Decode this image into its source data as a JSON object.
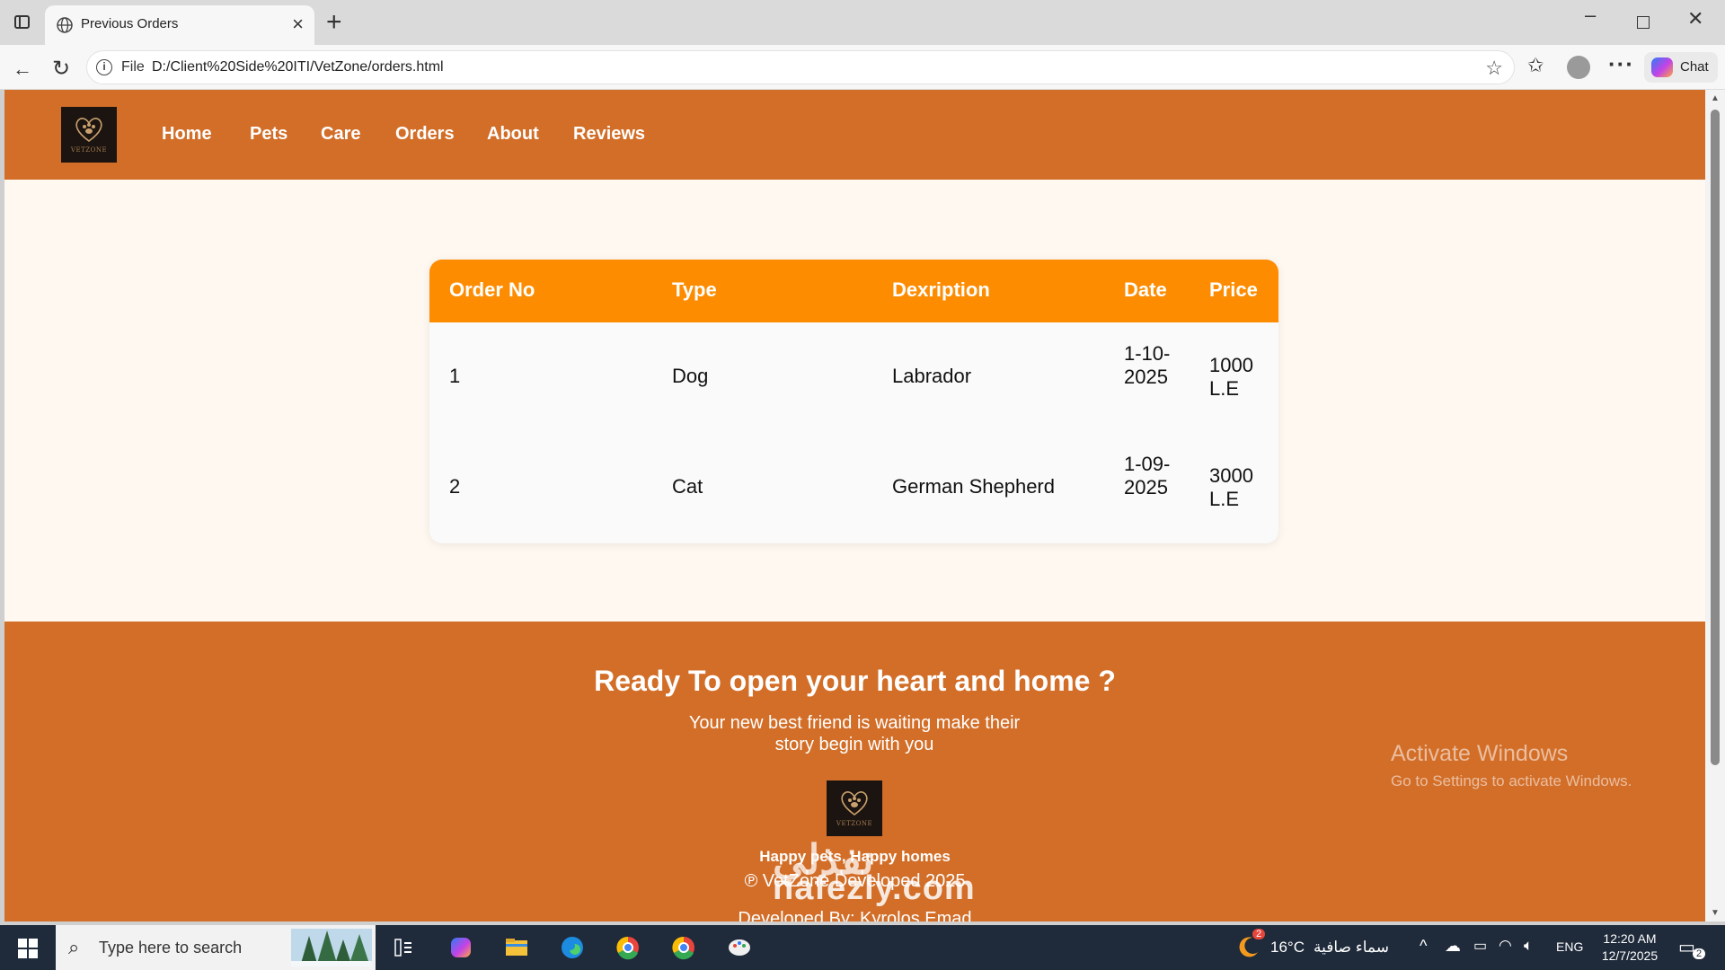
{
  "browser": {
    "tab_title": "Previous Orders",
    "url_prefix": "File",
    "url": "D:/Client%20Side%20ITI/VetZone/orders.html",
    "chat_label": "Chat"
  },
  "site": {
    "logo_text": "VETZONE",
    "nav": [
      "Home",
      "Pets",
      "Care",
      "Orders",
      "About",
      "Reviews"
    ]
  },
  "orders": {
    "headers": [
      "Order No",
      "Type",
      "Dexription",
      "Date",
      "Price"
    ],
    "rows": [
      [
        "1",
        "Dog",
        "Labrador",
        "1-10-2025",
        "1000 L.E"
      ],
      [
        "2",
        "Cat",
        "German Shepherd",
        "1-09-2025",
        "3000 L.E"
      ]
    ]
  },
  "footer": {
    "cta_title": "Ready To open your heart and home ?",
    "cta_text": "Your new best friend is waiting make their story begin with you",
    "tagline": "Happy pets, Happy homes",
    "copyright": "℗ VetZone Developed 2025",
    "developer": "Developed By: Kyrolos Emad"
  },
  "overlay": {
    "activate_title": "Activate Windows",
    "activate_sub": "Go to Settings to activate Windows.",
    "watermark": "nafezly.com",
    "watermark_ar": "نفذلي"
  },
  "taskbar": {
    "search_placeholder": "Type here to search",
    "weather": "16°C",
    "weather_desc": "سماء صافية",
    "weather_badge": "2",
    "lang": "ENG",
    "time": "12:20 AM",
    "date": "12/7/2025",
    "notif_count": "2"
  },
  "colors": {
    "brand_orange": "#d26e28",
    "table_header": "#fd8c00",
    "page_bg": "#fff8f1"
  }
}
